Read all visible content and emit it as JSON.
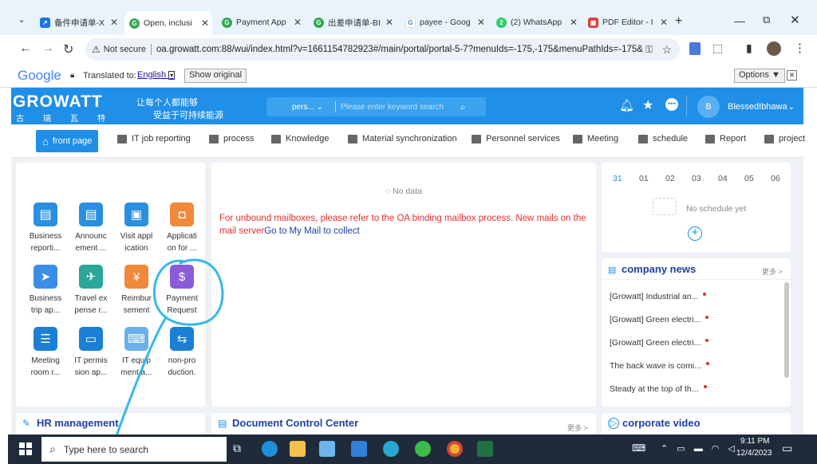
{
  "browser": {
    "tabs": [
      {
        "label": "备件申请单-X",
        "icon_color": "#1a73e8",
        "icon_glyph": "↗"
      },
      {
        "label": "Open, inclusi",
        "icon_color": "#34a853",
        "icon_glyph": "G",
        "active": true
      },
      {
        "label": "Payment App",
        "icon_color": "#34a853",
        "icon_glyph": "G"
      },
      {
        "label": "出差申请单-BI",
        "icon_color": "#34a853",
        "icon_glyph": "G"
      },
      {
        "label": "payee - Goog",
        "icon_color": "#4285f4",
        "icon_glyph": "G"
      },
      {
        "label": "(2) WhatsApp",
        "icon_color": "#25d366",
        "icon_glyph": "2"
      },
      {
        "label": "PDF Editor - I",
        "icon_color": "#e53935",
        "icon_glyph": "▦"
      }
    ],
    "not_secure": "Not secure",
    "url": "oa.growatt.com:88/wui/index.html?v=1661154782923#/main/portal/portal-5-7?menuIds=-175,-175&menuPathIds=-175&_..."
  },
  "translate": {
    "google": "Google",
    "translated_to": "Translated to:",
    "language": "English",
    "show_original": "Show original",
    "options": "Options ▼"
  },
  "oa": {
    "logo_text": "GROWATT",
    "logo_sub": [
      "古",
      "瑞",
      "瓦",
      "特"
    ],
    "slogan_1": "让每个人都能够",
    "slogan_2": "受益于可持续能源",
    "search_scope": "pers...",
    "search_placeholder": "Please enter keyword search",
    "user_initial": "B",
    "user_name": "BlessedIbhawa"
  },
  "menu": [
    {
      "label": "front page",
      "active": true
    },
    {
      "label": "IT job reporting"
    },
    {
      "label": "process"
    },
    {
      "label": "Knowledge"
    },
    {
      "label": "Material synchronization"
    },
    {
      "label": "Personnel services"
    },
    {
      "label": "Meeting"
    },
    {
      "label": "schedule"
    },
    {
      "label": "Report"
    },
    {
      "label": "project"
    }
  ],
  "apps": [
    {
      "line1": "Business",
      "line2": "reporti...",
      "color": "#2a8fe0",
      "glyph": "▤"
    },
    {
      "line1": "Announc",
      "line2": "ement ...",
      "color": "#2a8fe0",
      "glyph": "▤"
    },
    {
      "line1": "Visit appl",
      "line2": "ication",
      "color": "#2a8fe0",
      "glyph": "▣"
    },
    {
      "line1": "Applicati",
      "line2": "on for ...",
      "color": "#f0893a",
      "glyph": "◘"
    },
    {
      "line1": "Business",
      "line2": "trip ap...",
      "color": "#3b8ee8",
      "glyph": "➤"
    },
    {
      "line1": "Travel ex",
      "line2": "pense r...",
      "color": "#2aa79b",
      "glyph": "✈"
    },
    {
      "line1": "Reimbur",
      "line2": "sement",
      "color": "#f0893a",
      "glyph": "¥"
    },
    {
      "line1": "Payment",
      "line2": "Request",
      "color": "#8a5cd9",
      "glyph": "$"
    },
    {
      "line1": "Meeting",
      "line2": "room r...",
      "color": "#1c7fd6",
      "glyph": "☰"
    },
    {
      "line1": "IT permis",
      "line2": "sion ap...",
      "color": "#1c7fd6",
      "glyph": "▭"
    },
    {
      "line1": "IT equip",
      "line2": "ment a...",
      "color": "#6ab0e8",
      "glyph": "⌨"
    },
    {
      "line1": "non-pro",
      "line2": "duction.",
      "color": "#1c7fd6",
      "glyph": "⇆"
    }
  ],
  "mail": {
    "no_data": "No data",
    "notice": "For unbound mailboxes, please refer to the OA binding mailbox process. New mails on the mail server",
    "link": "Go to My Mail to collect"
  },
  "schedule": {
    "days": [
      "31",
      "01",
      "02",
      "03",
      "04",
      "05",
      "06"
    ],
    "empty": "No schedule yet"
  },
  "company_news": {
    "title": "company news",
    "more": "更多 >",
    "items": [
      "[Growatt] Industrial an...",
      "[Growatt] Green electri...",
      "[Growatt] Green electri...",
      "The back wave is comi...",
      "Steady at the top of th..."
    ]
  },
  "bottom_panels": {
    "hr": "HR management",
    "doc": "Document Control Center",
    "doc_more": "更多 >",
    "video": "corporate video"
  },
  "taskbar": {
    "search": "Type here to search",
    "time": "9:11 PM",
    "date": "12/4/2023"
  },
  "colors": {
    "accent": "#1f8fe8",
    "annotation": "#36b8ea",
    "notice": "#e03030",
    "link": "#1e3fa8"
  }
}
